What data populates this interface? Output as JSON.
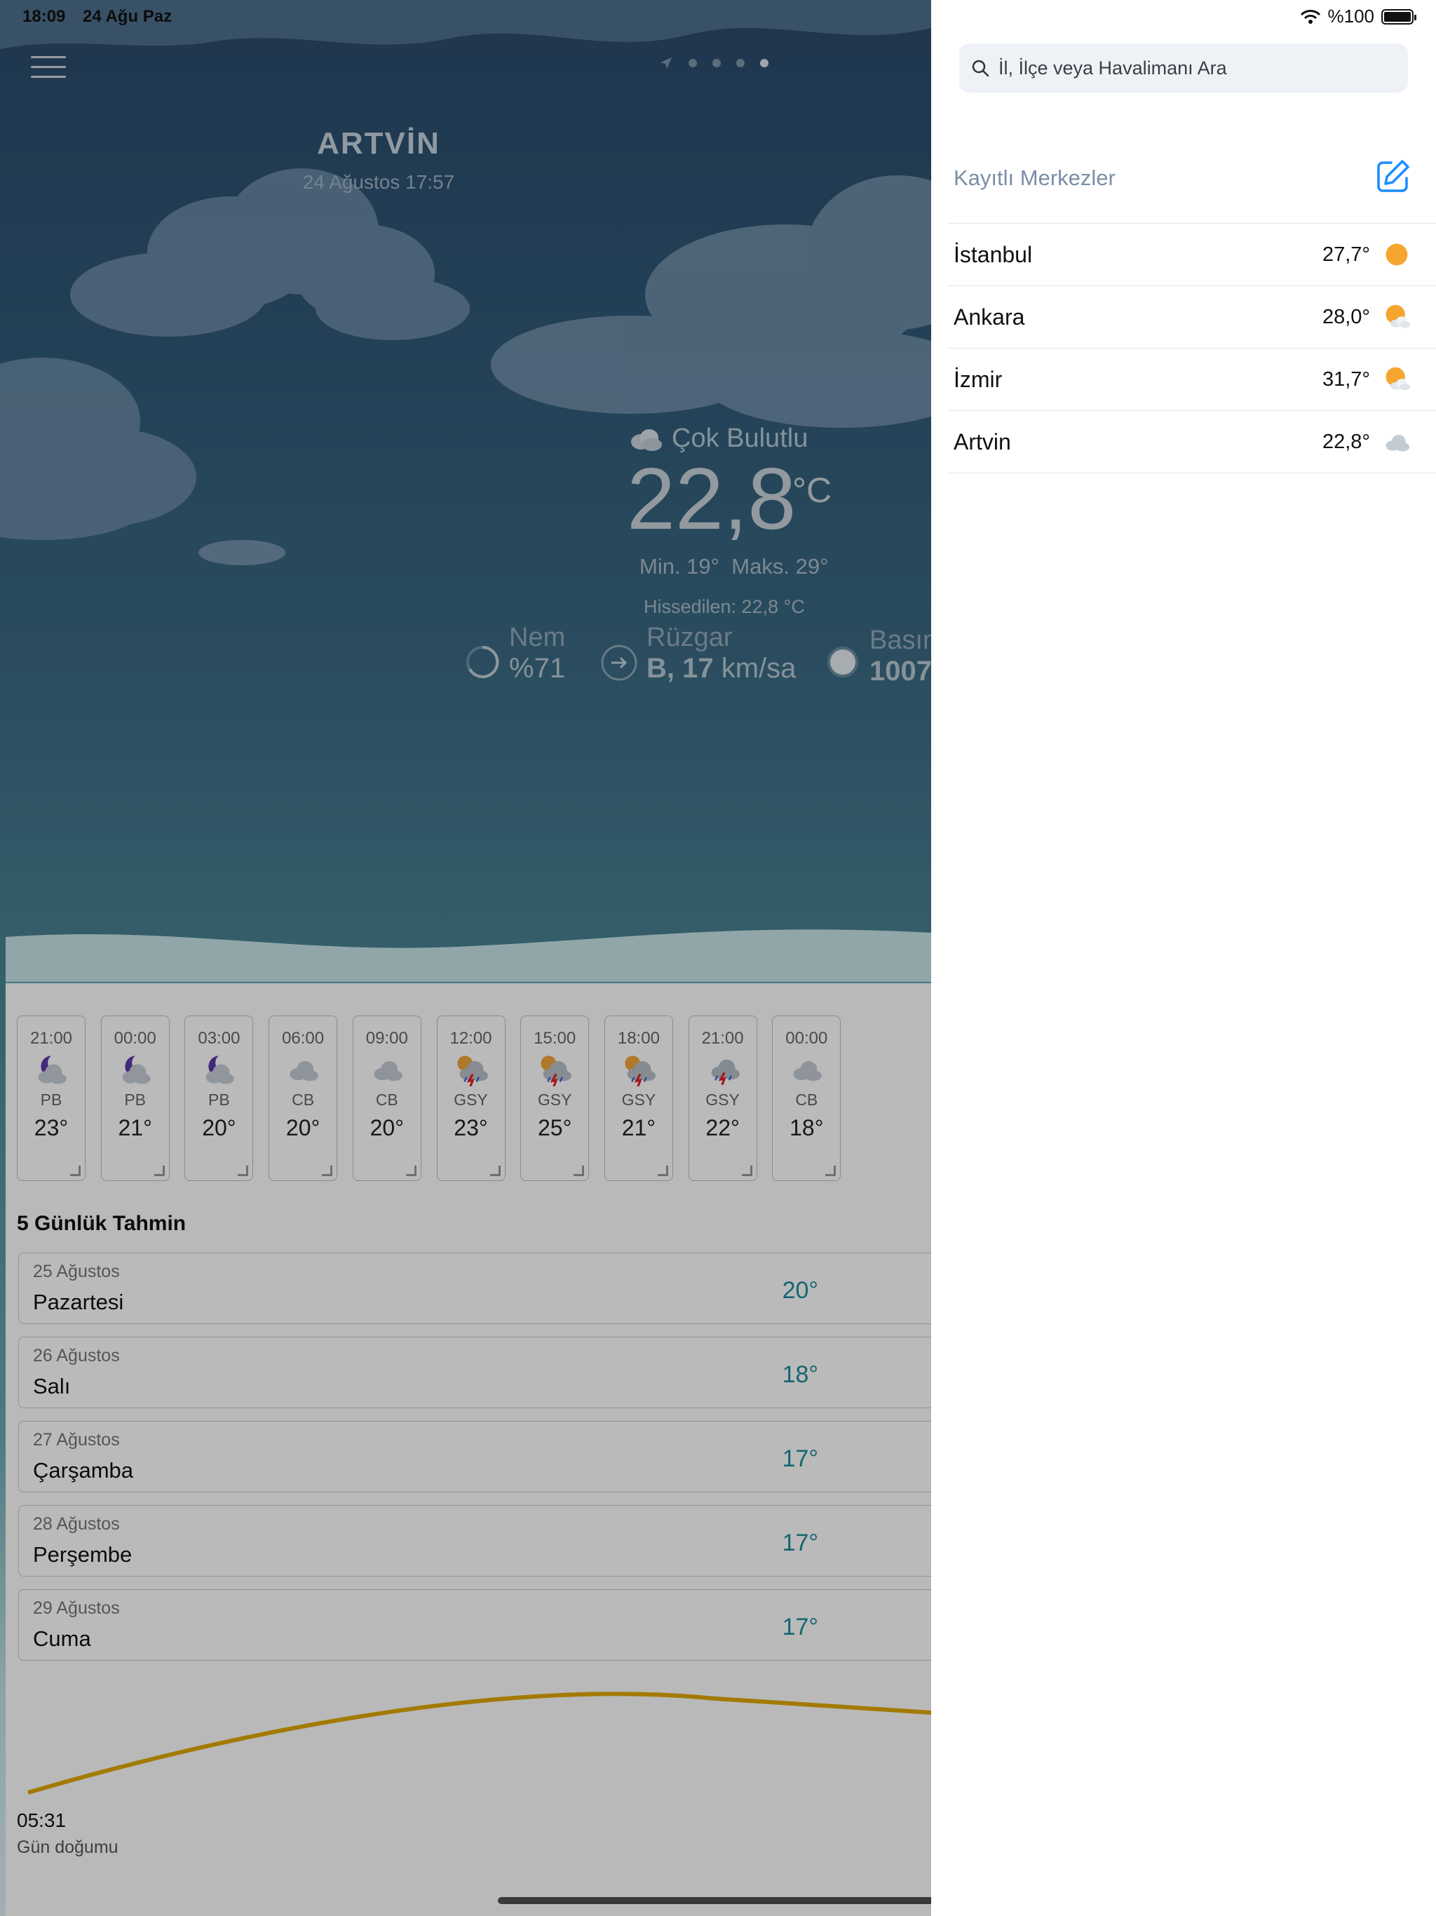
{
  "status": {
    "time": "18:09",
    "date": "24 Ağu Paz",
    "battery": "%100"
  },
  "weather": {
    "city": "ARTVİN",
    "datetime": "24 Ağustos 17:57",
    "condition": "Çok Bulutlu",
    "temperature": "22,8",
    "unit": "°C",
    "min": "Min. 19°",
    "max": "Maks. 29°",
    "feels_like": "Hissedilen: 22,8 °C",
    "humidity_label": "Nem",
    "humidity_value": "%71",
    "wind_label": "Rüzgar",
    "wind_dir": "B, 17",
    "wind_unit": "km/sa",
    "pressure_label": "Basınç",
    "pressure_value": "1007"
  },
  "hourly": [
    {
      "time": "21:00",
      "code": "PB",
      "temp": "23°",
      "icon": "moon-cloud-icon"
    },
    {
      "time": "00:00",
      "code": "PB",
      "temp": "21°",
      "icon": "moon-cloud-icon"
    },
    {
      "time": "03:00",
      "code": "PB",
      "temp": "20°",
      "icon": "moon-cloud-icon"
    },
    {
      "time": "06:00",
      "code": "CB",
      "temp": "20°",
      "icon": "cloud-icon"
    },
    {
      "time": "09:00",
      "code": "CB",
      "temp": "20°",
      "icon": "cloud-icon"
    },
    {
      "time": "12:00",
      "code": "GSY",
      "temp": "23°",
      "icon": "sun-storm-icon"
    },
    {
      "time": "15:00",
      "code": "GSY",
      "temp": "25°",
      "icon": "sun-storm-icon"
    },
    {
      "time": "18:00",
      "code": "GSY",
      "temp": "21°",
      "icon": "sun-storm-icon"
    },
    {
      "time": "21:00",
      "code": "GSY",
      "temp": "22°",
      "icon": "storm-icon"
    },
    {
      "time": "00:00",
      "code": "CB",
      "temp": "18°",
      "icon": "cloud-icon"
    }
  ],
  "forecast": {
    "title": "5 Günlük Tahmin",
    "days": [
      {
        "date": "25 Ağustos",
        "day": "Pazartesi",
        "temp": "20°"
      },
      {
        "date": "26 Ağustos",
        "day": "Salı",
        "temp": "18°"
      },
      {
        "date": "27 Ağustos",
        "day": "Çarşamba",
        "temp": "17°"
      },
      {
        "date": "28 Ağustos",
        "day": "Perşembe",
        "temp": "17°"
      },
      {
        "date": "29 Ağustos",
        "day": "Cuma",
        "temp": "17°"
      }
    ]
  },
  "sun": {
    "sunrise_time": "05:31",
    "sunrise_label": "Gün doğumu"
  },
  "sidebar": {
    "search_placeholder": "İl, İlçe veya Havalimanı Ara",
    "saved_title": "Kayıtlı Merkezler",
    "cities": [
      {
        "name": "İstanbul",
        "temp": "27,7°",
        "icon": "sun-icon"
      },
      {
        "name": "Ankara",
        "temp": "28,0°",
        "icon": "sun-cloud-icon"
      },
      {
        "name": "İzmir",
        "temp": "31,7°",
        "icon": "sun-cloud-icon"
      },
      {
        "name": "Artvin",
        "temp": "22,8°",
        "icon": "cloud-icon"
      }
    ]
  },
  "colors": {
    "accent": "#1a8cff",
    "forecast_temp": "#1e8c9a",
    "sun_arc": "#e0a800"
  }
}
